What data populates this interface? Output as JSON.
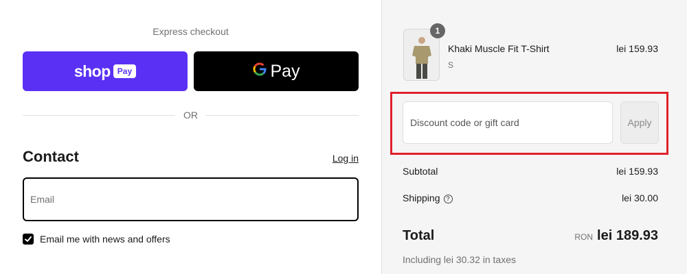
{
  "express": {
    "title": "Express checkout",
    "shop_pay": {
      "word": "shop",
      "badge": "Pay"
    },
    "google_pay": {
      "logo": "G",
      "word": "Pay"
    },
    "or_label": "OR"
  },
  "contact": {
    "title": "Contact",
    "login_label": "Log in",
    "email_placeholder": "Email",
    "email_value": "",
    "newsletter_label": "Email me with news and offers",
    "newsletter_checked": true
  },
  "order": {
    "item": {
      "name": "Khaki Muscle Fit T-Shirt",
      "variant": "S",
      "price": "lei 159.93",
      "quantity": "1",
      "thumbnail_icon": "product-photo-icon"
    },
    "discount": {
      "placeholder": "Discount code or gift card",
      "value": "",
      "apply_label": "Apply"
    },
    "subtotal": {
      "label": "Subtotal",
      "value": "lei 159.93"
    },
    "shipping": {
      "label": "Shipping",
      "value": "lei 30.00",
      "help_icon": "?"
    },
    "total": {
      "label": "Total",
      "currency": "RON",
      "value": "lei 189.93"
    },
    "tax_note": "Including lei 30.32 in taxes"
  },
  "colors": {
    "shop_pay_purple": "#5a31f4",
    "google_pay_black": "#000000",
    "highlight_red": "#e0202a",
    "summary_background": "#f5f5f5"
  }
}
